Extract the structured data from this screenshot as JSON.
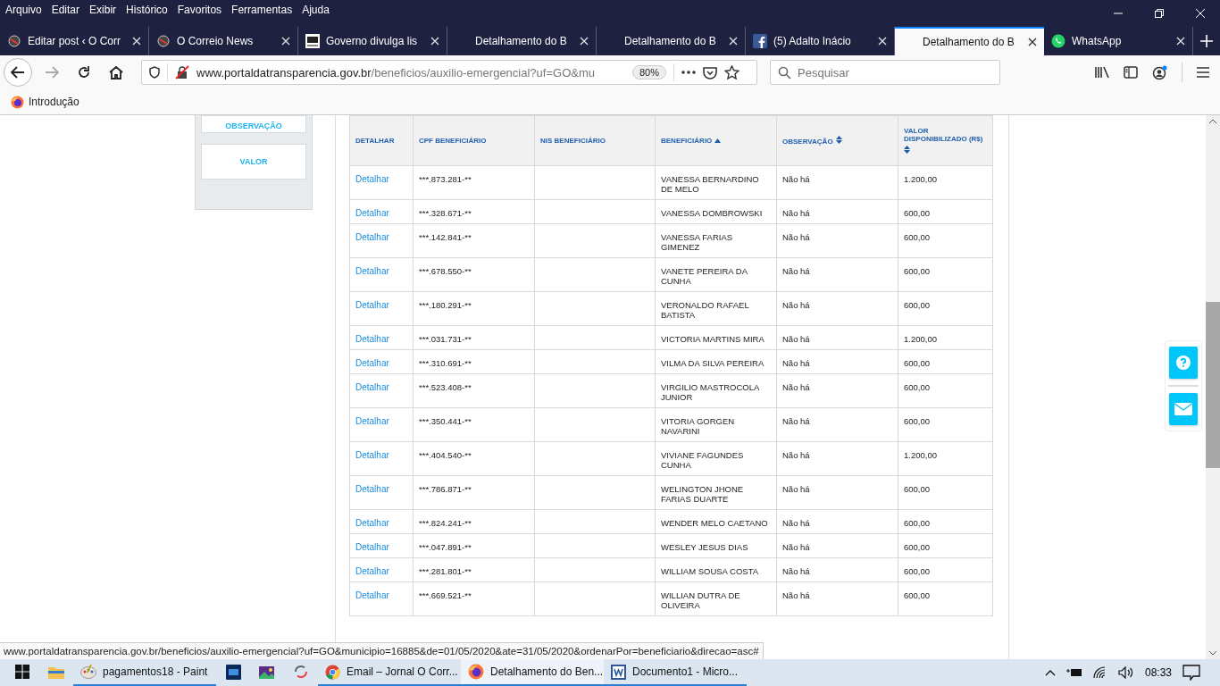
{
  "menu_bar": [
    "Arquivo",
    "Editar",
    "Exibir",
    "Histórico",
    "Favoritos",
    "Ferramentas",
    "Ajuda"
  ],
  "tabs": [
    {
      "title": "Editar post ‹ O Corr",
      "kind": "site",
      "selected": false
    },
    {
      "title": "O Correio News",
      "kind": "site",
      "selected": false
    },
    {
      "title": "Governo divulga lis",
      "kind": "news",
      "selected": false
    },
    {
      "title": "Detalhamento do B",
      "kind": "plain",
      "selected": false
    },
    {
      "title": "Detalhamento do B",
      "kind": "plain",
      "selected": false
    },
    {
      "title": "(5) Adalto Inácio",
      "kind": "facebook",
      "selected": false
    },
    {
      "title": "Detalhamento do B",
      "kind": "plain",
      "selected": true
    },
    {
      "title": "WhatsApp",
      "kind": "whatsapp",
      "selected": false
    }
  ],
  "toolbar": {
    "url_host": "www.portaldatransparencia.gov.br",
    "url_path": "/beneficios/auxilio-emergencial?uf=GO&mu",
    "zoom": "80%",
    "search_placeholder": "Pesquisar"
  },
  "bookmarks": [
    "Introdução"
  ],
  "filter_panel": {
    "buttons": [
      "OBSERVAÇÃO",
      "VALOR"
    ]
  },
  "table": {
    "columns": [
      {
        "label": "DETALHAR"
      },
      {
        "label": "CPF BENEFICIÁRIO"
      },
      {
        "label": "NIS BENEFICIÁRIO"
      },
      {
        "label": "BENEFICIÁRIO",
        "sortable": true,
        "sorted": true
      },
      {
        "label": "OBSERVAÇÃO",
        "sortable": true,
        "sorted": false
      },
      {
        "label": "VALOR DISPONIBILIZADO (R$)",
        "sortable": true,
        "sorted": false
      }
    ],
    "rows": [
      {
        "link": "Detalhar",
        "cpf": "***.873.281-**",
        "nis": "",
        "name": "VANESSA BERNARDINO DE MELO",
        "obs": "Não há",
        "value": "1.200,00"
      },
      {
        "link": "Detalhar",
        "cpf": "***.328.671-**",
        "nis": "",
        "name": "VANESSA DOMBROWSKI",
        "obs": "Não há",
        "value": "600,00"
      },
      {
        "link": "Detalhar",
        "cpf": "***.142.841-**",
        "nis": "",
        "name": "VANESSA FARIAS GIMENEZ",
        "obs": "Não há",
        "value": "600,00"
      },
      {
        "link": "Detalhar",
        "cpf": "***.678.550-**",
        "nis": "",
        "name": "VANETE PEREIRA DA CUNHA",
        "obs": "Não há",
        "value": "600,00"
      },
      {
        "link": "Detalhar",
        "cpf": "***.180.291-**",
        "nis": "",
        "name": "VERONALDO RAFAEL BATISTA",
        "obs": "Não há",
        "value": "600,00"
      },
      {
        "link": "Detalhar",
        "cpf": "***.031.731-**",
        "nis": "",
        "name": "VICTORIA MARTINS MIRA",
        "obs": "Não há",
        "value": "1.200,00"
      },
      {
        "link": "Detalhar",
        "cpf": "***.310.691-**",
        "nis": "",
        "name": "VILMA DA SILVA PEREIRA",
        "obs": "Não há",
        "value": "600,00"
      },
      {
        "link": "Detalhar",
        "cpf": "***.523.408-**",
        "nis": "",
        "name": "VIRGILIO MASTROCOLA JUNIOR",
        "obs": "Não há",
        "value": "600,00"
      },
      {
        "link": "Detalhar",
        "cpf": "***.350.441-**",
        "nis": "",
        "name": "VITORIA GORGEN NAVARINI",
        "obs": "Não há",
        "value": "600,00"
      },
      {
        "link": "Detalhar",
        "cpf": "***.404.540-**",
        "nis": "",
        "name": "VIVIANE FAGUNDES CUNHA",
        "obs": "Não há",
        "value": "1.200,00"
      },
      {
        "link": "Detalhar",
        "cpf": "***.786.871-**",
        "nis": "",
        "name": "WELINGTON JHONE FARIAS DUARTE",
        "obs": "Não há",
        "value": "600,00"
      },
      {
        "link": "Detalhar",
        "cpf": "***.824.241-**",
        "nis": "",
        "name": "WENDER MELO CAETANO",
        "obs": "Não há",
        "value": "600,00"
      },
      {
        "link": "Detalhar",
        "cpf": "***.047.891-**",
        "nis": "",
        "name": "WESLEY JESUS DIAS",
        "obs": "Não há",
        "value": "600,00"
      },
      {
        "link": "Detalhar",
        "cpf": "***.281.801-**",
        "nis": "",
        "name": "WILLIAM SOUSA COSTA",
        "obs": "Não há",
        "value": "600,00"
      },
      {
        "link": "Detalhar",
        "cpf": "***.669.521-**",
        "nis": "",
        "name": "WILLIAN DUTRA DE OLIVEIRA",
        "obs": "Não há",
        "value": "600,00"
      }
    ]
  },
  "status_url": "www.portaldatransparencia.gov.br/beneficios/auxilio-emergencial?uf=GO&municipio=16885&de=01/05/2020&ate=31/05/2020&ordenarPor=beneficiario&direcao=asc#",
  "taskbar": {
    "items": [
      {
        "kind": "start",
        "open": false,
        "selected": false
      },
      {
        "kind": "folder",
        "open": false,
        "selected": false
      },
      {
        "kind": "paint",
        "label": "pagamentos18 - Paint",
        "open": true,
        "selected": false
      },
      {
        "kind": "ps",
        "open": false,
        "selected": false
      },
      {
        "kind": "photo",
        "open": false,
        "selected": false
      },
      {
        "kind": "app",
        "open": false,
        "selected": false
      },
      {
        "kind": "chrome",
        "label": "Email – Jornal O Corr...",
        "open": true,
        "selected": false
      },
      {
        "kind": "firefox",
        "label": "Detalhamento do Ben...",
        "open": true,
        "selected": true
      },
      {
        "kind": "word",
        "label": "Documento1 - Micro...",
        "open": true,
        "selected": false
      }
    ],
    "clock": "08:33"
  }
}
